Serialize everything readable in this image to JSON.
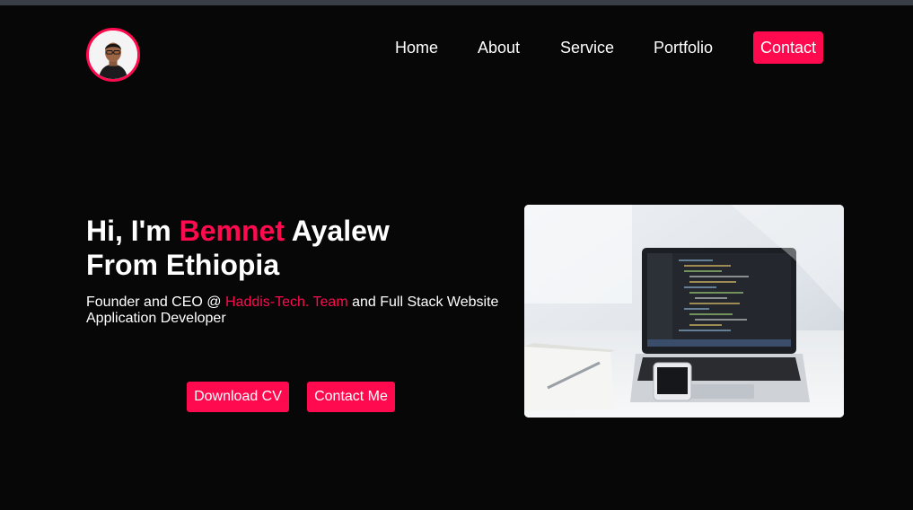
{
  "nav": {
    "items": [
      "Home",
      "About",
      "Service",
      "Portfolio"
    ],
    "contact_label": "Contact"
  },
  "hero": {
    "title_prefix": "Hi, I'm ",
    "first_name": "Bemnet",
    "last_name": " Ayalew",
    "title_line2": "From Ethiopia",
    "sub_prefix": "Founder and CEO @ ",
    "team": "Haddis-Tech. Team",
    "sub_suffix": " and Full Stack Website Application Developer",
    "download_label": "Download CV",
    "contact_label": "Contact Me"
  },
  "colors": {
    "accent": "#ff0a4e",
    "background": "#070708"
  },
  "icons": {
    "avatar": "profile-photo",
    "hero": "laptop-workspace-photo"
  }
}
